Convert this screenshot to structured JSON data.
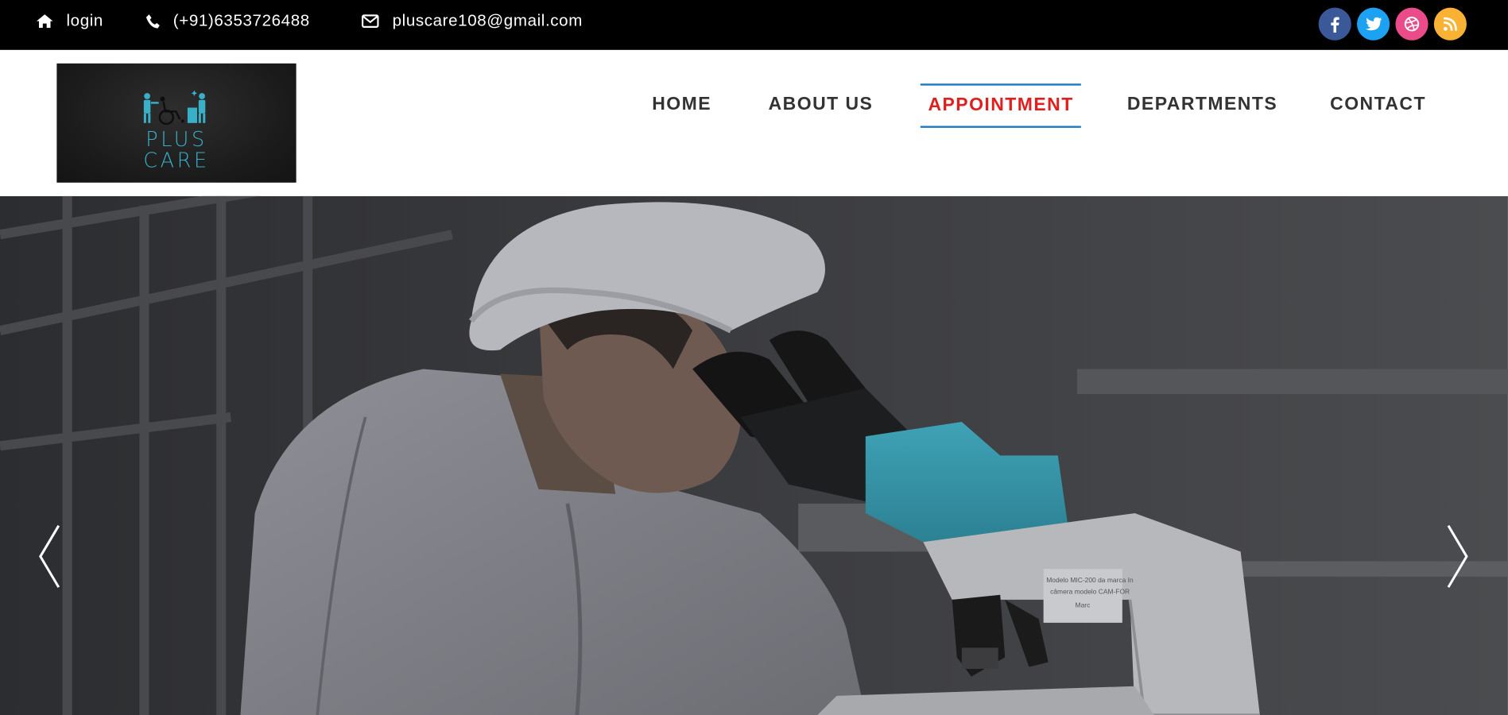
{
  "topbar": {
    "login_label": "login",
    "phone": "(+91)6353726488",
    "email": "pluscare108@gmail.com",
    "social": [
      {
        "icon": "facebook-icon",
        "color": "#3b5998"
      },
      {
        "icon": "twitter-icon",
        "color": "#1da1f2"
      },
      {
        "icon": "dribbble-icon",
        "color": "#ea4c89"
      },
      {
        "icon": "rss-icon",
        "color": "#f9b233"
      }
    ]
  },
  "logo": {
    "line1": "PLUS",
    "line2": "CARE",
    "color": "#3ab0c8"
  },
  "nav": {
    "items": [
      {
        "label": "HOME"
      },
      {
        "label": "ABOUT US"
      },
      {
        "label": "APPOINTMENT",
        "active": true
      },
      {
        "label": "DEPARTMENTS"
      },
      {
        "label": "CONTACT"
      }
    ],
    "active_color": "#e0201f",
    "underline_color": "#1a7bc4"
  },
  "hero": {
    "microscope_label": [
      "Modelo MIC-200 da marca In",
      "câmera modelo CAM-FOR",
      "Marc"
    ]
  }
}
